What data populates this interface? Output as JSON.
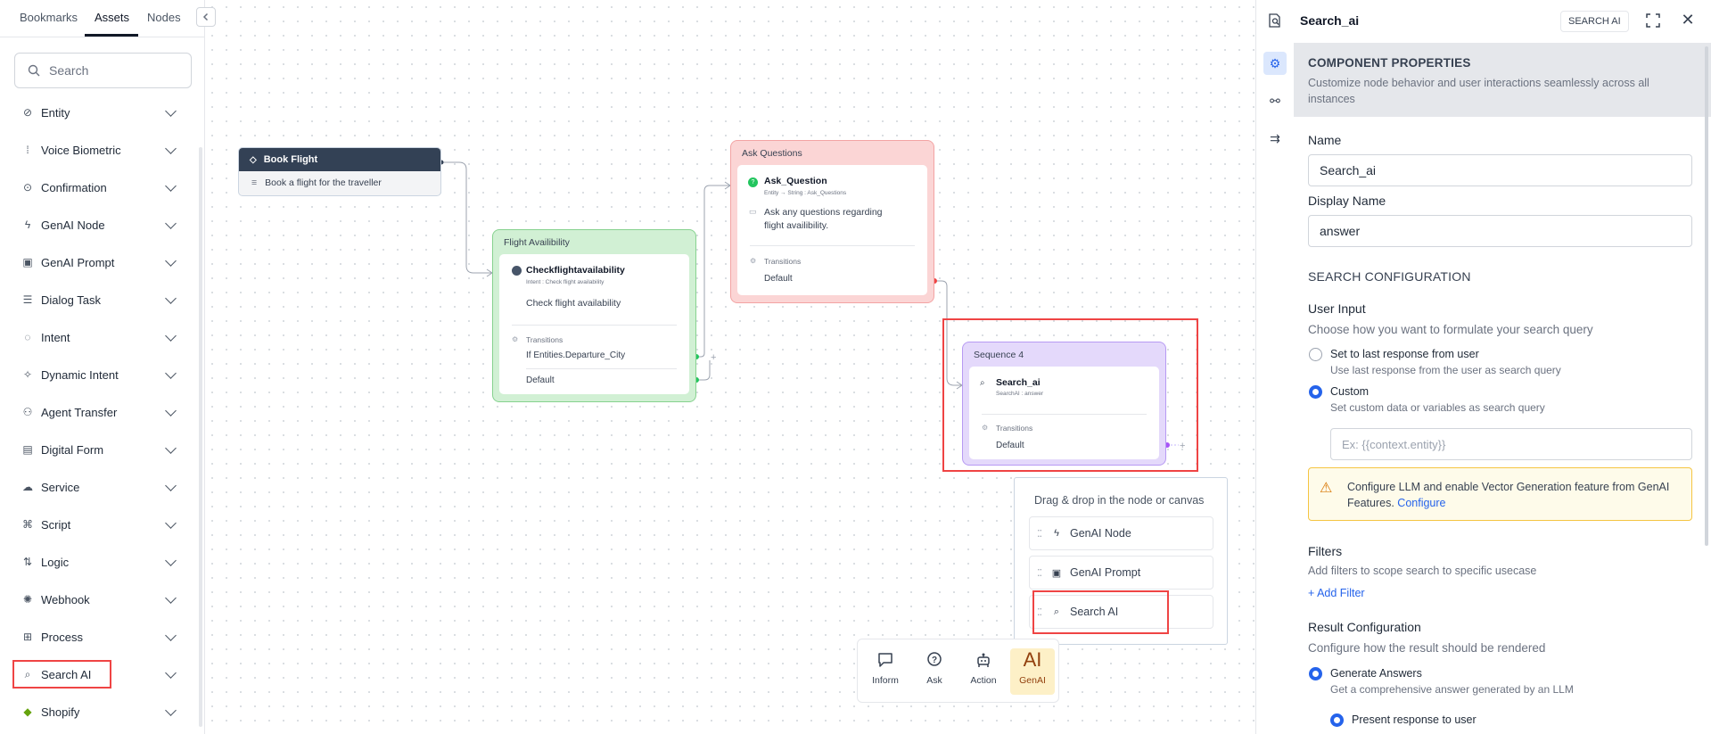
{
  "sidebar": {
    "tabs": [
      "Bookmarks",
      "Assets",
      "Nodes"
    ],
    "search_placeholder": "Search",
    "items": [
      {
        "label": "Entity",
        "icon": "entity-icon"
      },
      {
        "label": "Voice Biometric",
        "icon": "voice-biometric-icon"
      },
      {
        "label": "Confirmation",
        "icon": "confirmation-icon"
      },
      {
        "label": "GenAI Node",
        "icon": "lightning-icon"
      },
      {
        "label": "GenAI Prompt",
        "icon": "prompt-icon"
      },
      {
        "label": "Dialog Task",
        "icon": "dialog-icon"
      },
      {
        "label": "Intent",
        "icon": "intent-icon"
      },
      {
        "label": "Dynamic Intent",
        "icon": "dynamic-intent-icon"
      },
      {
        "label": "Agent Transfer",
        "icon": "agent-transfer-icon"
      },
      {
        "label": "Digital Form",
        "icon": "form-icon"
      },
      {
        "label": "Service",
        "icon": "cloud-icon"
      },
      {
        "label": "Script",
        "icon": "script-icon"
      },
      {
        "label": "Logic",
        "icon": "logic-icon"
      },
      {
        "label": "Webhook",
        "icon": "webhook-icon"
      },
      {
        "label": "Process",
        "icon": "process-icon"
      },
      {
        "label": "Search AI",
        "icon": "search-ai-icon"
      },
      {
        "label": "Shopify",
        "icon": "shopify-icon"
      }
    ]
  },
  "canvas": {
    "book_flight": {
      "title": "Book Flight",
      "description": "Book a flight for the traveller"
    },
    "flight_availability": {
      "group_title": "Flight Availibility",
      "node_title": "Checkflightavailability",
      "node_subtitle": "Intent : Check flight availability",
      "description": "Check flight availability",
      "transitions_label": "Transitions",
      "transitions": [
        "If Entities.Departure_City",
        "Default"
      ]
    },
    "ask_questions": {
      "group_title": "Ask Questions",
      "node_title": "Ask_Question",
      "node_subtitle": "Entity → String : Ask_Questions",
      "description_line1": "Ask any questions regarding",
      "description_line2": "flight availibility.",
      "transitions_label": "Transitions",
      "transitions": [
        "Default"
      ]
    },
    "sequence": {
      "group_title": "Sequence 4",
      "node_title": "Search_ai",
      "node_subtitle": "SearchAI : answer",
      "transitions_label": "Transitions",
      "transitions": [
        "Default"
      ]
    },
    "dnd_panel": {
      "title": "Drag & drop in the node or canvas",
      "items": [
        {
          "label": "GenAI Node",
          "icon": "lightning-icon"
        },
        {
          "label": "GenAI Prompt",
          "icon": "prompt-icon"
        },
        {
          "label": "Search AI",
          "icon": "search-ai-icon"
        }
      ]
    },
    "toolbar": [
      {
        "label": "Inform",
        "icon": "message-icon"
      },
      {
        "label": "Ask",
        "icon": "question-icon"
      },
      {
        "label": "Action",
        "icon": "robot-icon"
      },
      {
        "label": "GenAI",
        "icon": "ai-icon",
        "glyph": "AI"
      }
    ]
  },
  "panel": {
    "title": "Search_ai",
    "badge": "SEARCH AI",
    "section_title": "COMPONENT PROPERTIES",
    "section_desc": "Customize node behavior and user interactions seamlessly across all instances",
    "name_label": "Name",
    "name_value": "Search_ai",
    "display_name_label": "Display Name",
    "display_name_value": "answer",
    "search_config_title": "SEARCH CONFIGURATION",
    "user_input_label": "User Input",
    "user_input_desc": "Choose how you want to formulate your search query",
    "opt1_label": "Set to last response from user",
    "opt1_desc": "Use last response from the user as search query",
    "opt2_label": "Custom",
    "opt2_desc": "Set custom data or variables as search query",
    "custom_placeholder": "Ex: {{context.entity}}",
    "warning_text": "Configure LLM and enable Vector Generation feature from GenAI Features.",
    "warning_link": "Configure",
    "filters_label": "Filters",
    "filters_desc": "Add filters to scope search to specific usecase",
    "add_filter": "+ Add Filter",
    "result_label": "Result Configuration",
    "result_desc": "Configure how the result should be rendered",
    "result_opt1_label": "Generate Answers",
    "result_opt1_desc": "Get a comprehensive answer generated by an LLM",
    "result_opt2_label": "Present response to user"
  },
  "colors": {
    "accent": "#2563eb",
    "highlight": "#ef4444",
    "flight_group": "#d1f0d4",
    "ask_group": "#fbd5d5",
    "sequence_group": "#e4d9fb",
    "warning_bg": "#fefbea"
  }
}
